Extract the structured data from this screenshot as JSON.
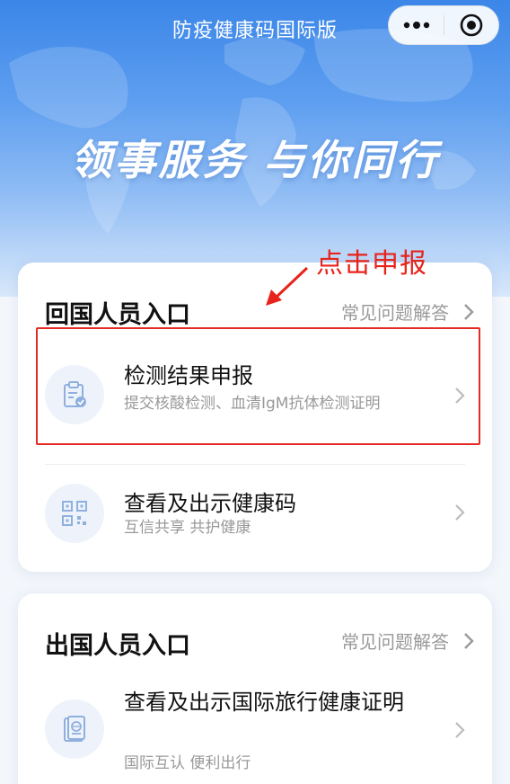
{
  "header": {
    "title": "防疫健康码国际版",
    "slogan": "领事服务 与你同行"
  },
  "capsule": {
    "more_icon": "more-dots-icon",
    "close_icon": "target-close-icon"
  },
  "annotation": {
    "text": "点击申报",
    "color": "#e8231b"
  },
  "return_section": {
    "title": "回国人员入口",
    "faq_label": "常见问题解答",
    "items": [
      {
        "title": "检测结果申报",
        "subtitle": "提交核酸检测、血清IgM抗体检测证明",
        "icon": "clipboard-check-icon"
      },
      {
        "title": "查看及出示健康码",
        "subtitle": "互信共享 共护健康",
        "icon": "qr-code-icon"
      }
    ]
  },
  "depart_section": {
    "title": "出国人员入口",
    "faq_label": "常见问题解答",
    "items": [
      {
        "title": "查看及出示国际旅行健康证明",
        "subtitle": "国际互认 便利出行",
        "icon": "passport-icon"
      }
    ]
  },
  "colors": {
    "accent": "#3b86e8",
    "highlight": "#e52b24"
  }
}
